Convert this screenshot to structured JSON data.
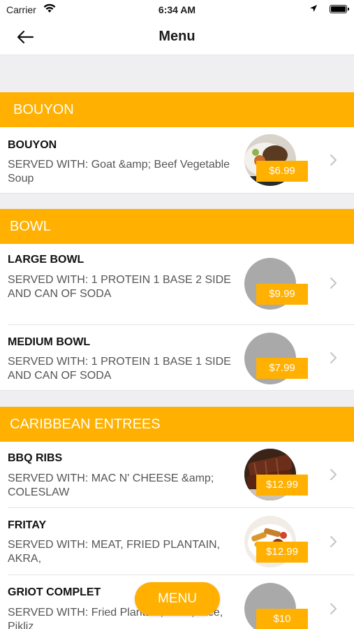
{
  "status_bar": {
    "carrier": "Carrier",
    "time": "6:34 AM"
  },
  "nav": {
    "title": "Menu"
  },
  "colors": {
    "accent": "#ffb000",
    "placeholder": "#a9a9a9",
    "background": "#efeff1"
  },
  "sections": [
    {
      "title": "BOUYON",
      "items": [
        {
          "name": "BOUYON",
          "description": "SERVED WITH: Goat &amp; Beef Vegetable Soup",
          "price": "$6.99",
          "image": "soup-photo"
        }
      ]
    },
    {
      "title": "BOWL",
      "items": [
        {
          "name": "LARGE BOWL",
          "description": "SERVED WITH: 1 PROTEIN 1 BASE 2 SIDE AND CAN OF SODA",
          "price": "$9.99",
          "image": "placeholder"
        },
        {
          "name": "MEDIUM BOWL",
          "description": "SERVED WITH:  1 PROTEIN 1 BASE 1 SIDE AND CAN OF SODA",
          "price": "$7.99",
          "image": "placeholder"
        }
      ]
    },
    {
      "title": "CARIBBEAN ENTREES",
      "items": [
        {
          "name": "BBQ RIBS",
          "description": "SERVED WITH: MAC N' CHEESE &amp; COLESLAW",
          "price": "$12.99",
          "image": "ribs-photo"
        },
        {
          "name": "FRITAY",
          "description": "SERVED WITH: MEAT, FRIED PLANTAIN, AKRA,",
          "price": "$12.99",
          "image": "fritay-photo"
        },
        {
          "name": "GRIOT COMPLET",
          "description": "SERVED WITH: Fried Plantain, Meat, Rice, Pikliz",
          "price": "$10",
          "image": "placeholder"
        }
      ]
    }
  ],
  "floating_button": {
    "label": "MENU"
  }
}
